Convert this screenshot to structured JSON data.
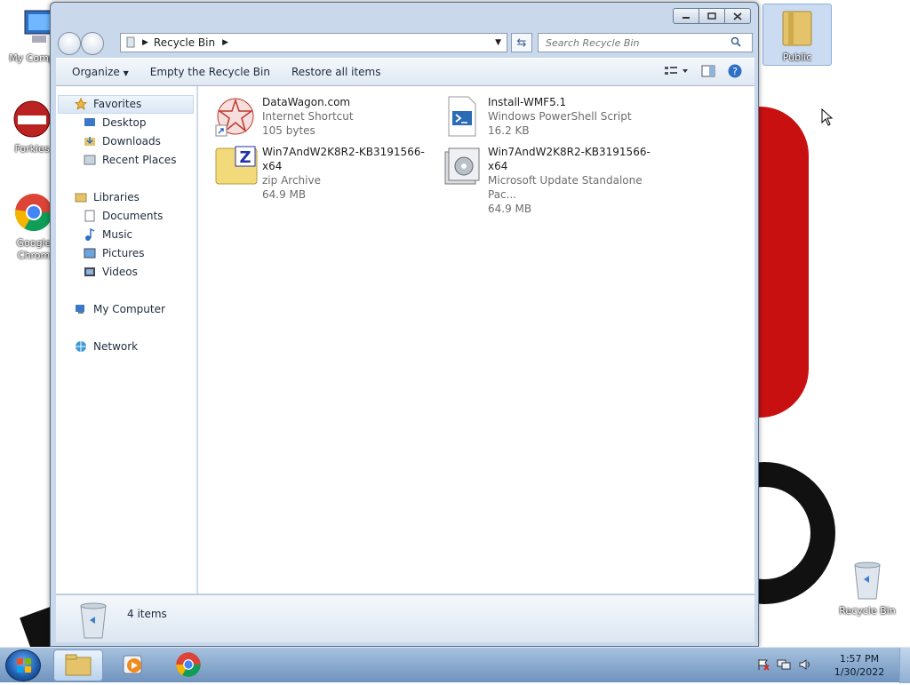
{
  "desktop": {
    "icons": [
      {
        "label": "My Comp"
      },
      {
        "label": "Forkies"
      },
      {
        "label": "Google Chrom"
      },
      {
        "label": "Public"
      },
      {
        "label": "Recycle Bin"
      }
    ]
  },
  "window": {
    "address": {
      "path": "Recycle Bin"
    },
    "search": {
      "placeholder": "Search Recycle Bin"
    },
    "toolbar": {
      "organize": "Organize",
      "empty": "Empty the Recycle Bin",
      "restore": "Restore all items"
    },
    "nav": {
      "favorites": "Favorites",
      "desktop": "Desktop",
      "downloads": "Downloads",
      "recent": "Recent Places",
      "libraries": "Libraries",
      "documents": "Documents",
      "music": "Music",
      "pictures": "Pictures",
      "videos": "Videos",
      "computer": "My Computer",
      "network": "Network"
    },
    "files": [
      {
        "name": "DataWagon.com",
        "type": "Internet Shortcut",
        "size": "105 bytes",
        "icon": "web-shortcut-icon"
      },
      {
        "name": "Install-WMF5.1",
        "type": "Windows PowerShell Script",
        "size": "16.2 KB",
        "icon": "powershell-script-icon"
      },
      {
        "name": "Win7AndW2K8R2-KB3191566-x64",
        "type": "zip Archive",
        "size": "64.9 MB",
        "icon": "zip-archive-icon"
      },
      {
        "name": "Win7AndW2K8R2-KB3191566-x64",
        "type": "Microsoft Update Standalone Pac...",
        "size": "64.9 MB",
        "icon": "update-package-icon"
      }
    ],
    "details": {
      "count": "4 items"
    }
  },
  "taskbar": {
    "clock": {
      "time": "1:57 PM",
      "date": "1/30/2022"
    }
  },
  "colors": {
    "accent": "#3b6ea5",
    "desktop_red": "#c81010"
  }
}
